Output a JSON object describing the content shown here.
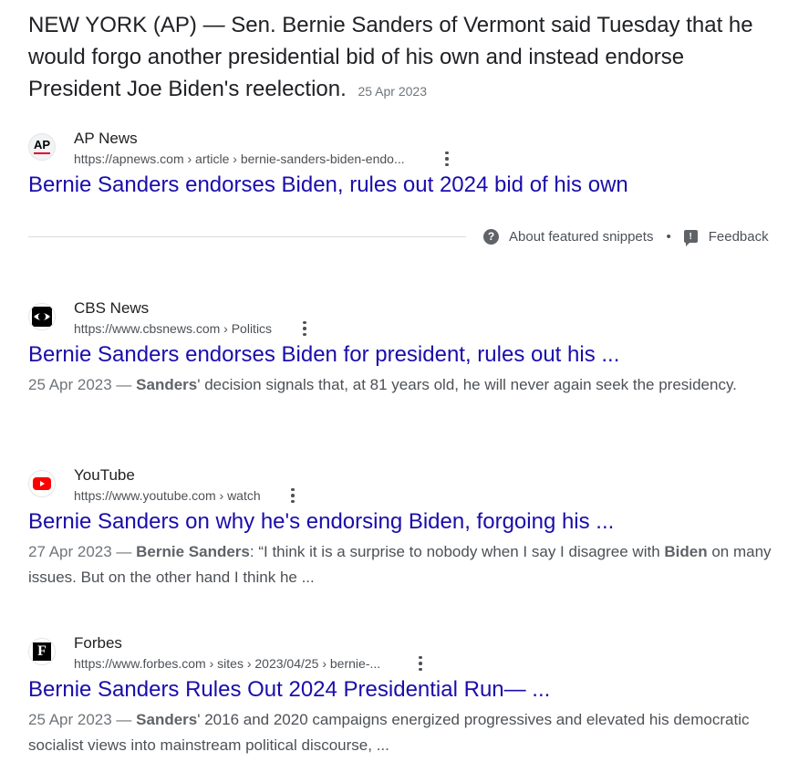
{
  "featured": {
    "snippet": "NEW YORK (AP) — Sen. Bernie Sanders of Vermont said Tuesday that he would forgo another presidential bid of his own and instead endorse President Joe Biden's reelection.",
    "date": "25 Apr 2023",
    "source_name": "AP News",
    "source_url": "https://apnews.com › article › bernie-sanders-biden-endo...",
    "favicon_text": "AP",
    "title": "Bernie Sanders endorses Biden, rules out 2024 bid of his own",
    "about_label": "About featured snippets",
    "separator": "•",
    "feedback_label": "Feedback"
  },
  "results": [
    {
      "source_name": "CBS News",
      "source_url": "https://www.cbsnews.com › Politics",
      "title": "Bernie Sanders endorses Biden for president, rules out his ...",
      "date": "25 Apr 2023 —",
      "desc_parts": [
        "Sanders",
        "' decision signals that, at 81 years old, he will never again seek the presidency."
      ]
    },
    {
      "source_name": "YouTube",
      "source_url": "https://www.youtube.com › watch",
      "title": "Bernie Sanders on why he's endorsing Biden, forgoing his ...",
      "date": "27 Apr 2023 —",
      "desc_parts": [
        "Bernie Sanders",
        ": “I think it is a surprise to nobody when I say I disagree with ",
        "Biden",
        " on many issues. But on the other hand I think he ..."
      ]
    },
    {
      "source_name": "Forbes",
      "source_url": "https://www.forbes.com › sites › 2023/04/25 › bernie-...",
      "favicon_text": "F",
      "title": "Bernie Sanders Rules Out 2024 Presidential Run— ...",
      "date": "25 Apr 2023 —",
      "desc_parts": [
        "Sanders",
        "' 2016 and 2020 campaigns energized progressives and elevated his democratic socialist views into mainstream political discourse, ..."
      ]
    }
  ],
  "colors": {
    "link": "#1a0dab",
    "text": "#202124",
    "muted": "#4d5156",
    "youtube_red": "#ff0000",
    "ap_red": "#e4002b"
  }
}
